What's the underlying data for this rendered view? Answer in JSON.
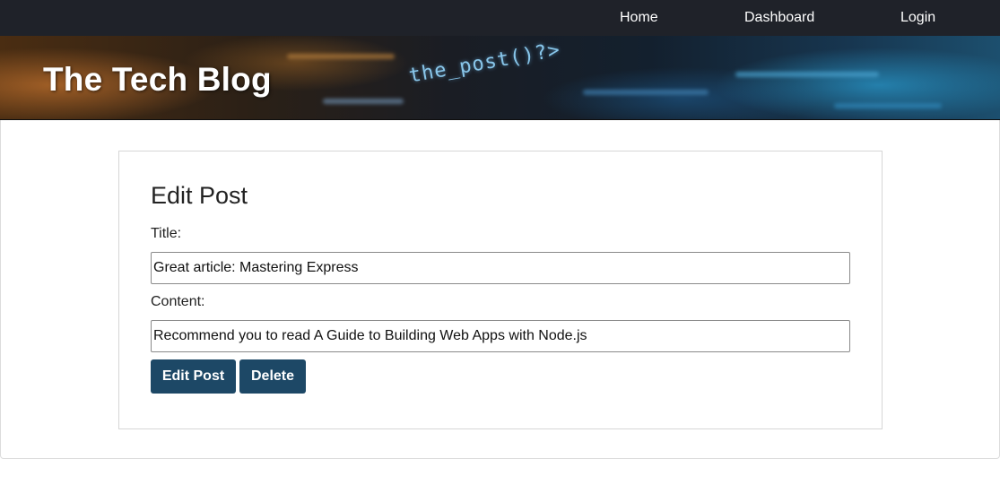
{
  "nav": {
    "home": "Home",
    "dashboard": "Dashboard",
    "login": "Login"
  },
  "banner": {
    "title": "The Tech Blog",
    "code_text": "the_post()?>"
  },
  "form": {
    "heading": "Edit Post",
    "title_label": "Title:",
    "title_value": "Great article: Mastering Express",
    "content_label": "Content:",
    "content_value": "Recommend you to read A Guide to Building Web Apps with Node.js",
    "edit_button": "Edit Post",
    "delete_button": "Delete"
  },
  "colors": {
    "nav_bg": "#1f2229",
    "button_bg": "#1d4866"
  }
}
